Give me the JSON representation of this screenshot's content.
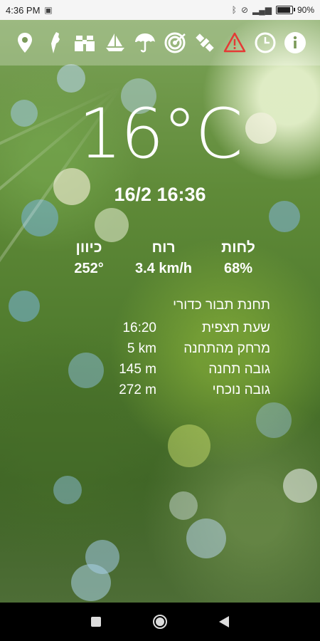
{
  "status_bar": {
    "time": "4:36 PM",
    "battery": "90%",
    "battery_level": 0.9
  },
  "toolbar": {
    "icons": [
      "location-pin-icon",
      "israel-map-icon",
      "binoculars-icon",
      "sailboat-icon",
      "umbrella-icon",
      "radar-icon",
      "satellite-icon",
      "warning-icon",
      "clock-icon",
      "info-icon"
    ],
    "colors": {
      "icon": "#ffffff",
      "warning": "#e53935"
    }
  },
  "weather": {
    "temperature": "16°C",
    "datetime": "16/2 16:36"
  },
  "metrics": [
    {
      "label": "לחות",
      "value": "68%"
    },
    {
      "label": "רוח",
      "value": "3.4 km/h"
    },
    {
      "label": "כיוון",
      "value": "252°"
    }
  ],
  "station": {
    "name": "תחנת תבור כדורי",
    "rows": [
      {
        "label": "שעת תצפית",
        "value": "16:20"
      },
      {
        "label": "מרחק מהתחנה",
        "value": "5 km"
      },
      {
        "label": "גובה תחנה",
        "value": "145 m"
      },
      {
        "label": "גובה נוכחי",
        "value": "272 m"
      }
    ]
  }
}
